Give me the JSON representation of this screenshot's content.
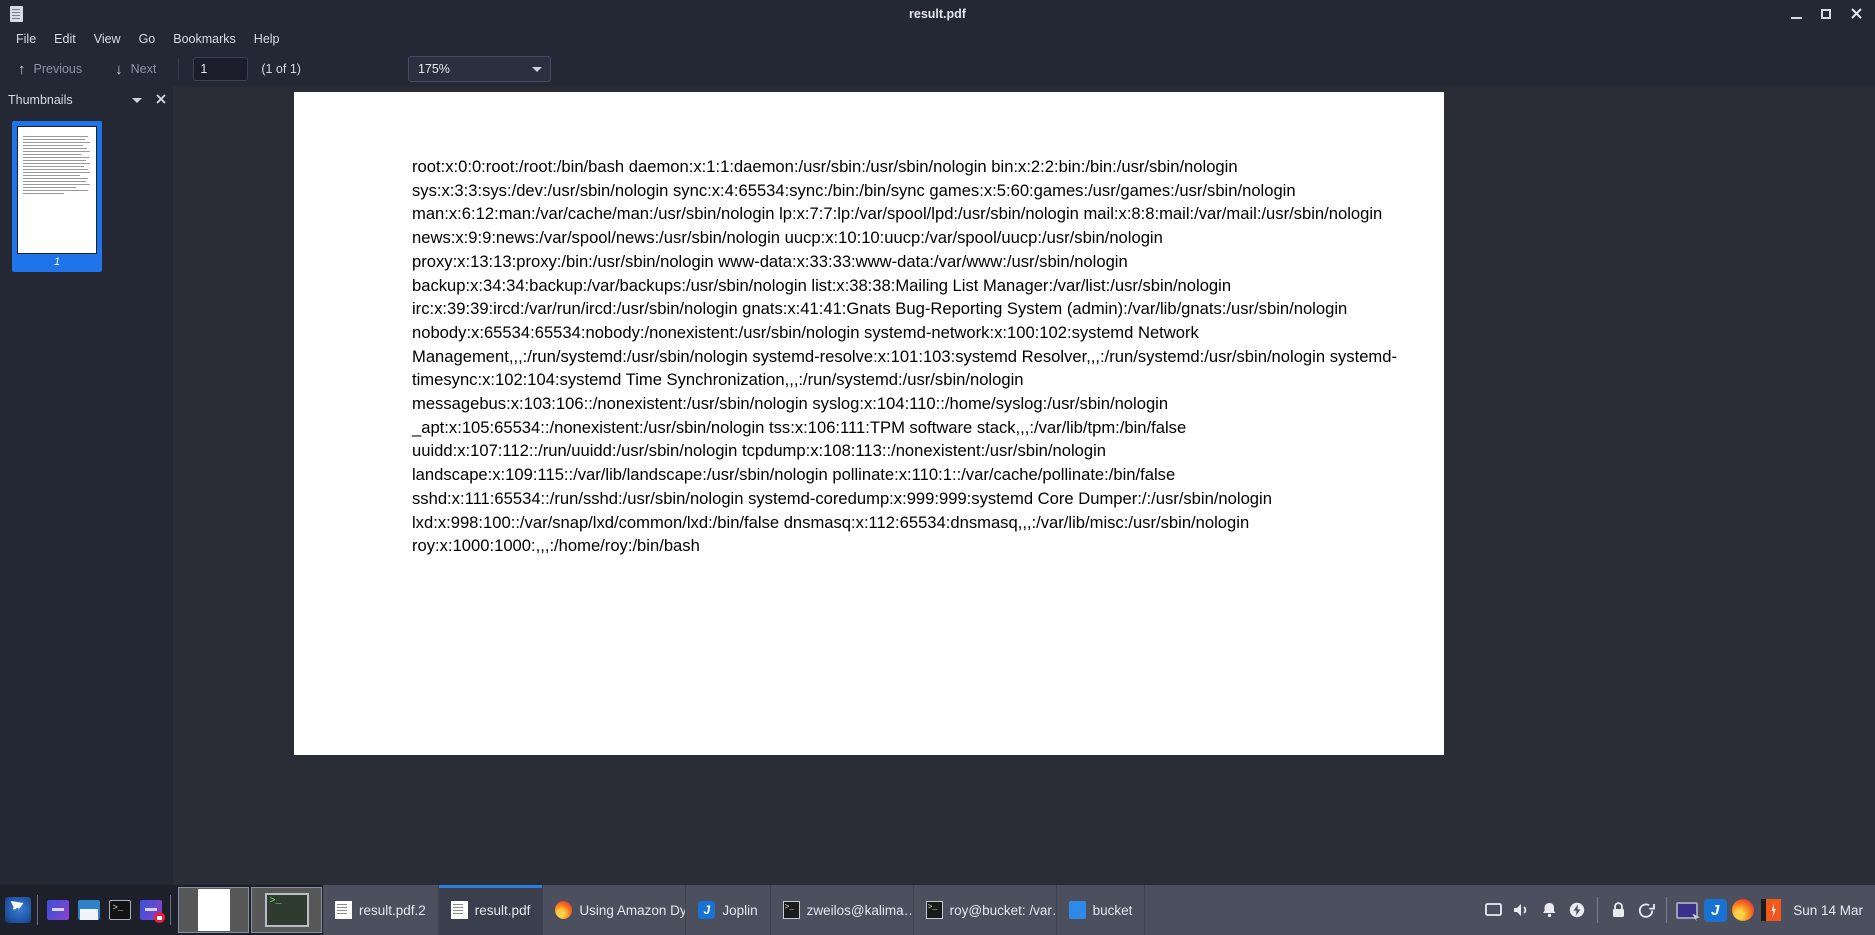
{
  "window": {
    "title": "result.pdf",
    "app_icon": "document-icon",
    "minimize_label": "Minimize",
    "maximize_label": "Maximize",
    "close_label": "Close"
  },
  "menubar": {
    "items": [
      {
        "label": "File"
      },
      {
        "label": "Edit"
      },
      {
        "label": "View"
      },
      {
        "label": "Go"
      },
      {
        "label": "Bookmarks"
      },
      {
        "label": "Help"
      }
    ]
  },
  "toolbar": {
    "previous_label": "Previous",
    "previous_icon": "arrow-up-icon",
    "next_label": "Next",
    "next_icon": "arrow-down-icon",
    "page_value": "1",
    "page_placeholder": "1",
    "page_count_label": "(1 of 1)",
    "zoom_value": "175%",
    "zoom_icon": "chevron-down-icon"
  },
  "sidebar": {
    "title": "Thumbnails",
    "collapse_icon": "chevron-down-icon",
    "close_icon": "close-icon",
    "thumbnails": [
      {
        "page_number": "1",
        "selected": true
      }
    ]
  },
  "document": {
    "body": "root:x:0:0:root:/root:/bin/bash daemon:x:1:1:daemon:/usr/sbin:/usr/sbin/nologin bin:x:2:2:bin:/bin:/usr/sbin/nologin sys:x:3:3:sys:/dev:/usr/sbin/nologin sync:x:4:65534:sync:/bin:/bin/sync games:x:5:60:games:/usr/games:/usr/sbin/nologin man:x:6:12:man:/var/cache/man:/usr/sbin/nologin lp:x:7:7:lp:/var/spool/lpd:/usr/sbin/nologin mail:x:8:8:mail:/var/mail:/usr/sbin/nologin news:x:9:9:news:/var/spool/news:/usr/sbin/nologin uucp:x:10:10:uucp:/var/spool/uucp:/usr/sbin/nologin proxy:x:13:13:proxy:/bin:/usr/sbin/nologin www-data:x:33:33:www-data:/var/www:/usr/sbin/nologin backup:x:34:34:backup:/var/backups:/usr/sbin/nologin list:x:38:38:Mailing List Manager:/var/list:/usr/sbin/nologin irc:x:39:39:ircd:/var/run/ircd:/usr/sbin/nologin gnats:x:41:41:Gnats Bug-Reporting System (admin):/var/lib/gnats:/usr/sbin/nologin nobody:x:65534:65534:nobody:/nonexistent:/usr/sbin/nologin systemd-network:x:100:102:systemd Network Management,,,:/run/systemd:/usr/sbin/nologin systemd-resolve:x:101:103:systemd Resolver,,,:/run/systemd:/usr/sbin/nologin systemd-timesync:x:102:104:systemd Time Synchronization,,,:/run/systemd:/usr/sbin/nologin messagebus:x:103:106::/nonexistent:/usr/sbin/nologin syslog:x:104:110::/home/syslog:/usr/sbin/nologin _apt:x:105:65534::/nonexistent:/usr/sbin/nologin tss:x:106:111:TPM software stack,,,:/var/lib/tpm:/bin/false uuidd:x:107:112::/run/uuidd:/usr/sbin/nologin tcpdump:x:108:113::/nonexistent:/usr/sbin/nologin landscape:x:109:115::/var/lib/landscape:/usr/sbin/nologin pollinate:x:110:1::/var/cache/pollinate:/bin/false sshd:x:111:65534::/run/sshd:/usr/sbin/nologin systemd-coredump:x:999:999:systemd Core Dumper:/:/usr/sbin/nologin lxd:x:998:100::/var/snap/lxd/common/lxd:/bin/false dnsmasq:x:112:65534:dnsmasq,,,:/var/lib/misc:/usr/sbin/nologin roy:x:1000:1000:,,,:/home/roy:/bin/bash"
  },
  "taskbar": {
    "launchers": [
      {
        "name": "kali-menu-icon",
        "label": "Kali Menu"
      },
      {
        "name": "terminal-gradient-icon",
        "label": "Terminal"
      },
      {
        "name": "file-manager-icon",
        "label": "Files"
      },
      {
        "name": "terminal-icon",
        "label": "Terminal"
      },
      {
        "name": "screen-recorder-icon",
        "label": "Recorder"
      }
    ],
    "window_previews": [
      {
        "name": "document-preview",
        "label": "Document preview"
      },
      {
        "name": "terminal-preview",
        "label": "Terminal preview"
      }
    ],
    "tasks": [
      {
        "label": "result.pdf.2",
        "icon": "document-icon",
        "active": false
      },
      {
        "label": "result.pdf",
        "icon": "document-icon",
        "active": true
      },
      {
        "label": "Using Amazon Dy…",
        "icon": "firefox-icon",
        "active": false
      },
      {
        "label": "Joplin",
        "icon": "joplin-icon",
        "active": false
      },
      {
        "label": "zweilos@kalima…",
        "icon": "terminal-icon",
        "active": false
      },
      {
        "label": "roy@bucket: /var…",
        "icon": "terminal-icon",
        "active": false
      },
      {
        "label": "bucket",
        "icon": "folder-icon",
        "active": false
      }
    ],
    "tray": [
      {
        "name": "display-icon",
        "glyph": "▭"
      },
      {
        "name": "volume-icon",
        "glyph": "🔊"
      },
      {
        "name": "notification-bell-icon",
        "glyph": "🔔"
      },
      {
        "name": "power-icon",
        "glyph": "⚡"
      },
      {
        "name": "lock-icon",
        "glyph": "🔒"
      },
      {
        "name": "logout-icon",
        "glyph": "↪"
      }
    ],
    "tray_apps": [
      {
        "name": "screen-share-icon"
      },
      {
        "name": "joplin-tray-icon"
      },
      {
        "name": "firefox-tray-icon"
      },
      {
        "name": "flash-app-tray-icon"
      }
    ],
    "clock": "Sun 14 Mar"
  },
  "colors": {
    "accent": "#2b7de0",
    "titlebar_bg": "#242734",
    "taskbar_bg": "#4b4f5e",
    "page_bg": "#ffffff",
    "viewer_bg": "#2b2d36",
    "thumb_selected": "#1e74e8"
  }
}
